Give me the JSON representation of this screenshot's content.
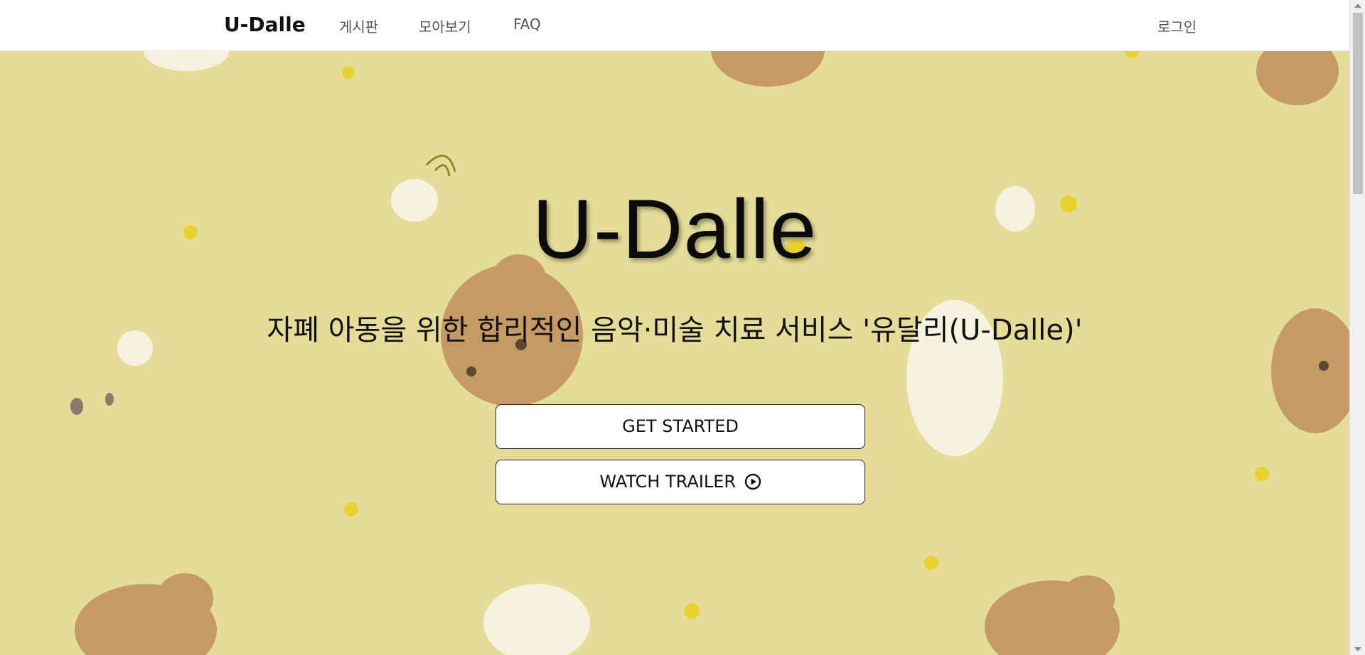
{
  "nav": {
    "brand": "U-Dalle",
    "links": [
      "게시판",
      "모아보기",
      "FAQ"
    ],
    "login": "로그인"
  },
  "hero": {
    "title": "U-Dalle",
    "subtitle": "자폐 아동을 위한 합리적인 음악·미술 치료 서비스 '유달리(U-Dalle)'",
    "get_started": "GET STARTED",
    "watch_trailer": "WATCH TRAILER",
    "play_icon": "play-circle-icon"
  },
  "colors": {
    "hero_background": "#e4dc98",
    "bear_brown": "#c69a64",
    "flower_white": "#f6f2e0"
  }
}
